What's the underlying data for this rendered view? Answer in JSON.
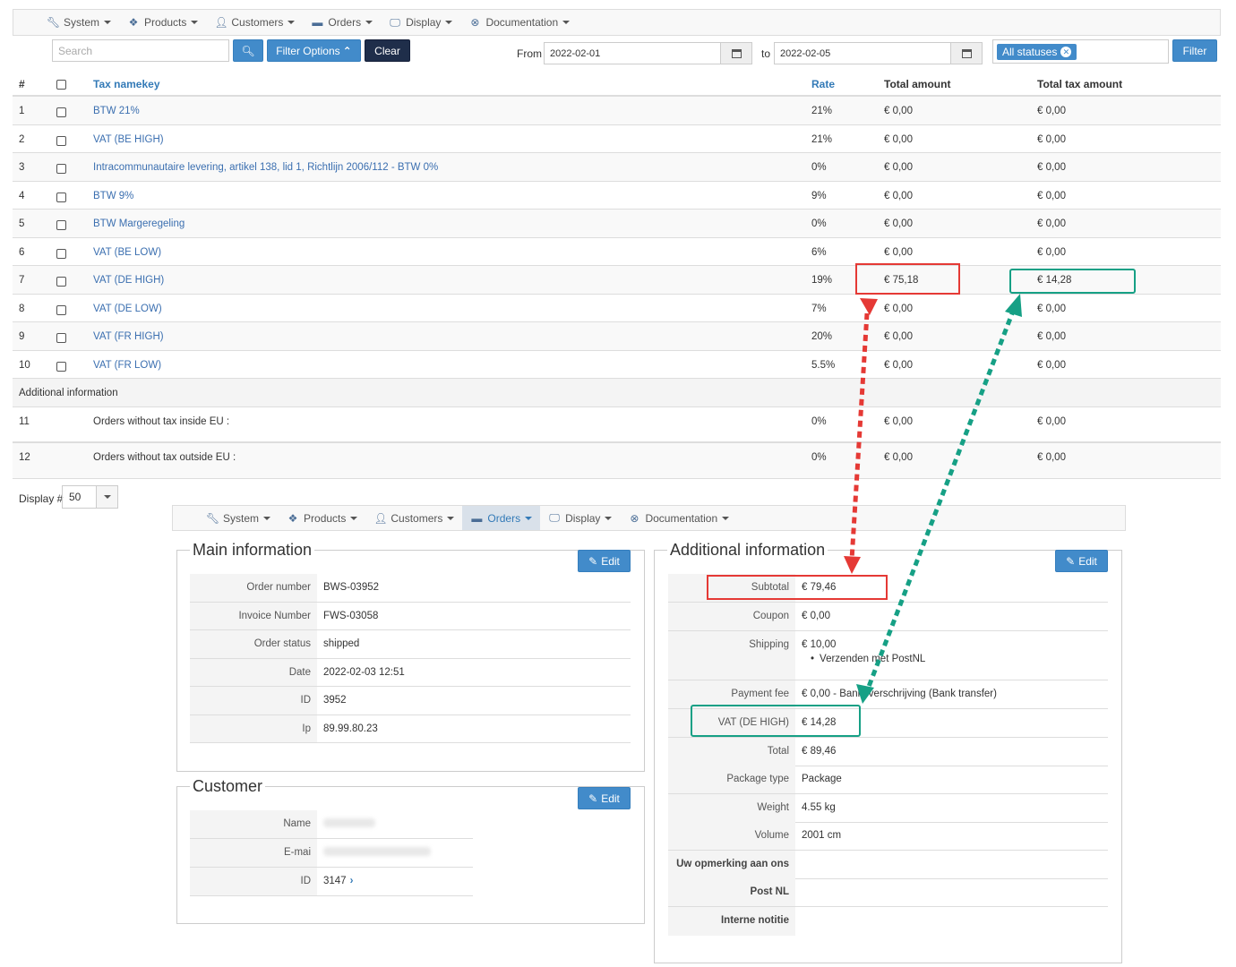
{
  "nav": {
    "items": [
      {
        "icon": "wrench-icon",
        "label": "System"
      },
      {
        "icon": "cubes-icon",
        "label": "Products"
      },
      {
        "icon": "user-icon",
        "label": "Customers"
      },
      {
        "icon": "credit-card-icon",
        "label": "Orders"
      },
      {
        "icon": "monitor-icon",
        "label": "Display"
      },
      {
        "icon": "lifebuoy-icon",
        "label": "Documentation"
      }
    ],
    "active_second": "Orders"
  },
  "filter": {
    "search_placeholder": "Search",
    "filter_options_label": "Filter Options",
    "clear_label": "Clear",
    "from_label": "From",
    "from_value": "2022-02-01",
    "to_label": "to",
    "to_value": "2022-02-05",
    "status_tag": "All statuses",
    "filter_label": "Filter"
  },
  "table": {
    "headers": {
      "num": "#",
      "namekey": "Tax namekey",
      "rate": "Rate",
      "total": "Total amount",
      "tax": "Total tax amount"
    },
    "rows": [
      {
        "num": "1",
        "name": "BTW 21%",
        "rate": "21%",
        "total": "€ 0,00",
        "tax": "€ 0,00"
      },
      {
        "num": "2",
        "name": "VAT (BE HIGH)",
        "rate": "21%",
        "total": "€ 0,00",
        "tax": "€ 0,00"
      },
      {
        "num": "3",
        "name": "Intracommunautaire levering, artikel 138, lid 1, Richtlijn 2006/112 - BTW 0%",
        "rate": "0%",
        "total": "€ 0,00",
        "tax": "€ 0,00"
      },
      {
        "num": "4",
        "name": "BTW 9%",
        "rate": "9%",
        "total": "€ 0,00",
        "tax": "€ 0,00"
      },
      {
        "num": "5",
        "name": "BTW Margeregeling",
        "rate": "0%",
        "total": "€ 0,00",
        "tax": "€ 0,00"
      },
      {
        "num": "6",
        "name": "VAT (BE LOW)",
        "rate": "6%",
        "total": "€ 0,00",
        "tax": "€ 0,00"
      },
      {
        "num": "7",
        "name": "VAT (DE HIGH)",
        "rate": "19%",
        "total": "€ 75,18",
        "tax": "€ 14,28"
      },
      {
        "num": "8",
        "name": "VAT (DE LOW)",
        "rate": "7%",
        "total": "€ 0,00",
        "tax": "€ 0,00"
      },
      {
        "num": "9",
        "name": "VAT (FR HIGH)",
        "rate": "20%",
        "total": "€ 0,00",
        "tax": "€ 0,00"
      },
      {
        "num": "10",
        "name": "VAT (FR LOW)",
        "rate": "5.5%",
        "total": "€ 0,00",
        "tax": "€ 0,00"
      }
    ],
    "additional_label": "Additional information",
    "extra_rows": [
      {
        "num": "11",
        "name": "Orders without tax inside EU :",
        "rate": "0%",
        "total": "€ 0,00",
        "tax": "€ 0,00"
      },
      {
        "num": "12",
        "name": "Orders without tax outside EU :",
        "rate": "0%",
        "total": "€ 0,00",
        "tax": "€ 0,00"
      }
    ],
    "display_label": "Display #",
    "display_value": "50"
  },
  "main_info": {
    "legend": "Main information",
    "edit_label": "Edit",
    "rows": [
      {
        "k": "Order number",
        "v": "BWS-03952"
      },
      {
        "k": "Invoice Number",
        "v": "FWS-03058"
      },
      {
        "k": "Order status",
        "v": "shipped"
      },
      {
        "k": "Date",
        "v": "2022-02-03 12:51"
      },
      {
        "k": "ID",
        "v": "3952"
      },
      {
        "k": "Ip",
        "v": "89.99.80.23"
      }
    ]
  },
  "customer": {
    "legend": "Customer",
    "edit_label": "Edit",
    "name_label": "Name",
    "email_label": "E-mai",
    "id_label": "ID",
    "id_value": "3147"
  },
  "additional": {
    "legend": "Additional information",
    "edit_label": "Edit",
    "subtotal_k": "Subtotal",
    "subtotal_v": "€ 79,46",
    "coupon_k": "Coupon",
    "coupon_v": "€ 0,00",
    "shipping_k": "Shipping",
    "shipping_v": "€ 10,00",
    "shipping_method": "Verzenden met PostNL",
    "payment_k": "Payment fee",
    "payment_v": "€ 0,00 - Bankoverschrijving (Bank transfer)",
    "vat_k": "VAT (DE HIGH)",
    "vat_v": "€ 14,28",
    "total_k": "Total",
    "total_v": "€ 89,46",
    "package_k": "Package type",
    "package_v": "Package",
    "weight_k": "Weight",
    "weight_v": "4.55 kg",
    "volume_k": "Volume",
    "volume_v": "2001 cm",
    "remark_k": "Uw opmerking aan ons",
    "postnl_k": "Post NL",
    "note_k": "Interne notitie"
  },
  "colors": {
    "accent": "#428bca",
    "highlight_red": "#e53935",
    "highlight_green": "#16a085"
  }
}
